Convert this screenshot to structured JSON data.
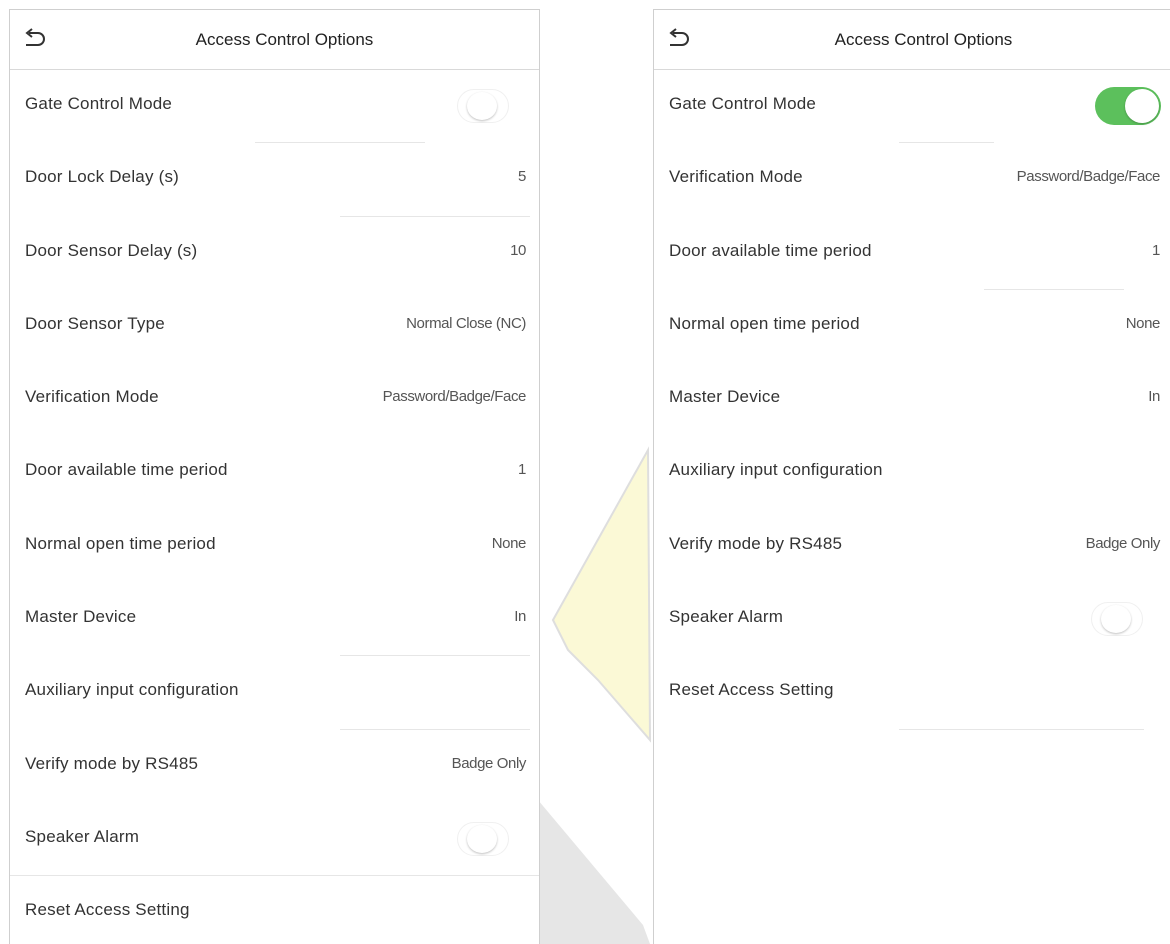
{
  "left": {
    "title": "Access Control Options",
    "items": [
      {
        "label": "Gate Control Mode",
        "toggle": "off"
      },
      {
        "label": "Door Lock Delay (s)",
        "value": "5"
      },
      {
        "label": "Door Sensor Delay (s)",
        "value": "10"
      },
      {
        "label": "Door Sensor Type",
        "value": "Normal Close (NC)"
      },
      {
        "label": "Verification Mode",
        "value": "Password/Badge/Face"
      },
      {
        "label": "Door available time period",
        "value": "1"
      },
      {
        "label": "Normal open time period",
        "value": "None"
      },
      {
        "label": "Master Device",
        "value": "In"
      },
      {
        "label": "Auxiliary input configuration"
      },
      {
        "label": "Verify mode by RS485",
        "value": "Badge Only"
      },
      {
        "label": "Speaker Alarm",
        "toggle": "off"
      },
      {
        "label": "Reset Access Setting"
      }
    ]
  },
  "right": {
    "title": "Access Control Options",
    "items": [
      {
        "label": "Gate Control Mode",
        "toggle": "on"
      },
      {
        "label": "Verification Mode",
        "value": "Password/Badge/Face"
      },
      {
        "label": "Door available time period",
        "value": "1"
      },
      {
        "label": "Normal open time period",
        "value": "None"
      },
      {
        "label": "Master Device",
        "value": "In"
      },
      {
        "label": "Auxiliary input configuration"
      },
      {
        "label": "Verify mode by RS485",
        "value": "Badge Only"
      },
      {
        "label": "Speaker Alarm",
        "toggle": "off"
      },
      {
        "label": "Reset Access Setting"
      }
    ]
  },
  "colors": {
    "toggle_on": "#5cc05c",
    "arrow_fill": "#fbf9d6"
  },
  "icons": {
    "back": "back-arrow-icon",
    "transition": "transition-arrow-icon"
  }
}
